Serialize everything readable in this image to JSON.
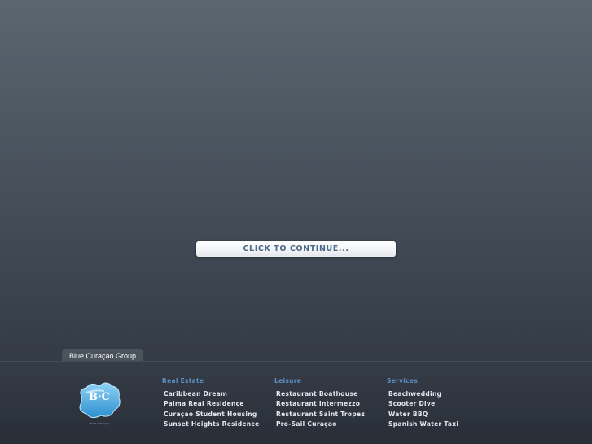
{
  "continue_button": {
    "label": "CLICK TO CONTINUE..."
  },
  "group_tab": {
    "label": "Blue Curaçao Group"
  },
  "footer": {
    "logo": {
      "letters": "B·C",
      "text": "BLUE CURAÇAO",
      "icon": "blue-curacao-logo-icon"
    },
    "columns": [
      {
        "heading": "Real Estate",
        "links": [
          "Caribbean Dream",
          "Palma Real Residence",
          "Curaçao Student Housing",
          "Sunset Heights Residence"
        ]
      },
      {
        "heading": "Leisure",
        "links": [
          "Restaurant Boathouse",
          "Restaurant Intermezzo",
          "Restaurant Saint Tropez",
          "Pro-Sail Curaçao"
        ]
      },
      {
        "heading": "Services",
        "links": [
          "Beachwedding",
          "Scooter Dive",
          "Water BBQ",
          "Spanish Water Taxi"
        ]
      }
    ]
  },
  "colors": {
    "background_top": "#5b6671",
    "background_bottom": "#2b313b",
    "heading_blue": "#5d91c6",
    "button_text": "#4a6a8a",
    "logo_blue": "#3fa7df"
  }
}
